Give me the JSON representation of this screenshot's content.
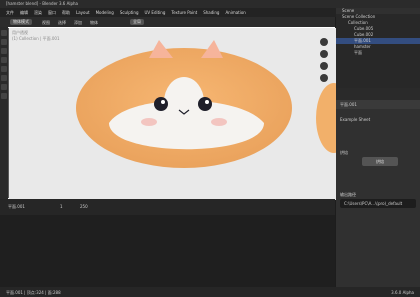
{
  "window": {
    "title": "[hamster blend] - Blender 3.6 Alpha"
  },
  "menus": [
    "文件",
    "编辑",
    "渲染",
    "窗口",
    "帮助",
    "Layout",
    "Modeling",
    "Sculpting",
    "UV Editing",
    "Texture Paint",
    "Shading",
    "Animation"
  ],
  "toolbar": {
    "mode": "物体模式",
    "view": "视图",
    "select": "选择",
    "add": "添加",
    "object": "物体",
    "transform": "全局"
  },
  "viewport": {
    "label1": "用户透视",
    "label2": "(1) Collection | 平面.001"
  },
  "outliner": {
    "title": "Scene",
    "items": [
      "Scene Collection",
      "Collection",
      "Cube.005",
      "Cube.002",
      "平面.001",
      "hamster",
      "平面"
    ]
  },
  "properties": {
    "object_name": "平面.001",
    "panel_title": "Example Sheet",
    "bake_label": "烘焙",
    "bake_button": "烘焙",
    "path_label": "输出路径",
    "path_value": "C:\\Users\\PC\\A...\\(pro)_default"
  },
  "timeline": {
    "frame_label": "平面.001",
    "start": "1",
    "end": "250"
  },
  "status": {
    "left": "平面.001 | 顶点:324 | 面:288",
    "right": "3.6.0 Alpha"
  }
}
